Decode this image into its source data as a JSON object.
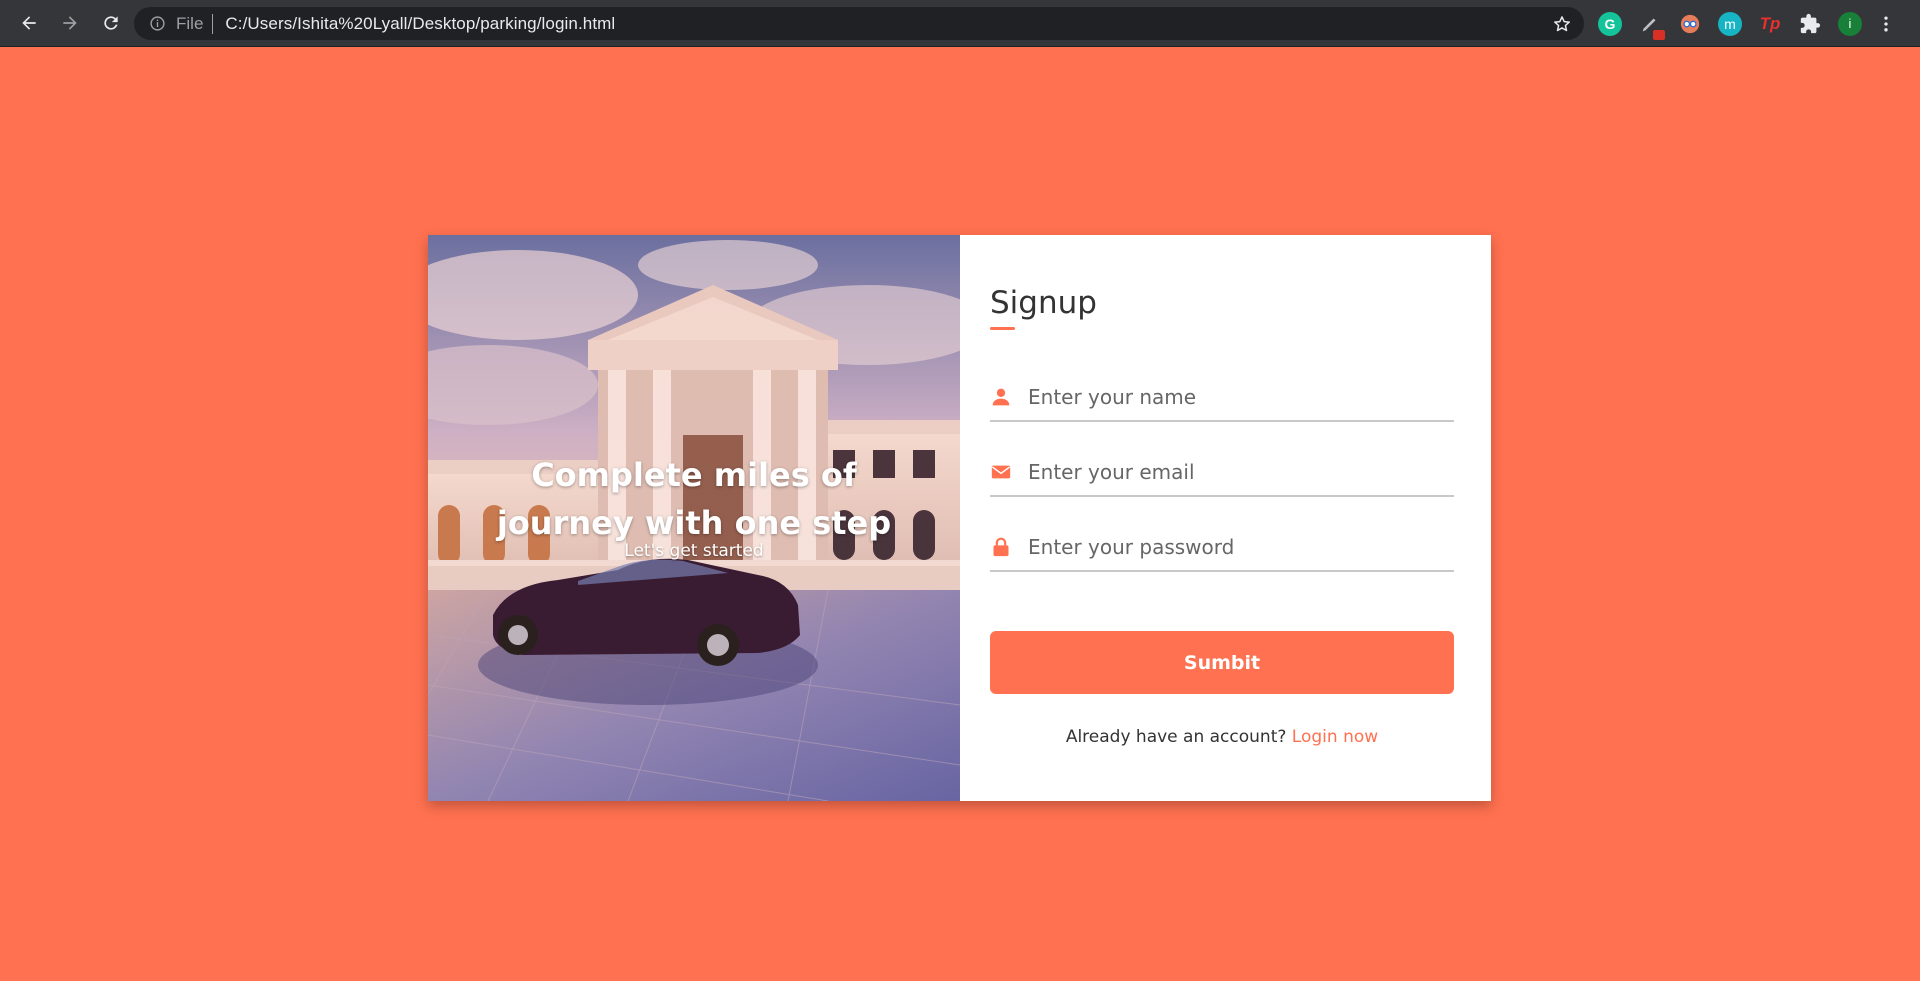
{
  "browser": {
    "omnibox": {
      "scheme_label": "File",
      "url": "C:/Users/Ishita%20Lyall/Desktop/parking/login.html"
    },
    "extensions": [
      {
        "name": "grammarly-icon",
        "label": "G"
      },
      {
        "name": "pen-extension-icon",
        "label": ""
      },
      {
        "name": "glasses-extension-icon",
        "label": ""
      },
      {
        "name": "m-extension-icon",
        "label": "m"
      },
      {
        "name": "tp-extension-icon",
        "label": "Tp"
      },
      {
        "name": "puzzle-icon",
        "label": ""
      },
      {
        "name": "profile-avatar",
        "label": "i"
      }
    ]
  },
  "hero": {
    "title": "Complete miles of journey with one step",
    "subtitle": "Let's get started"
  },
  "form": {
    "title": "Signup",
    "fields": {
      "name": {
        "placeholder": "Enter your name",
        "icon": "user-icon"
      },
      "email": {
        "placeholder": "Enter your email",
        "icon": "envelope-icon"
      },
      "password": {
        "placeholder": "Enter your password",
        "icon": "lock-icon"
      }
    },
    "submit_label": "Sumbit",
    "login_prompt": "Already have an account?",
    "login_link": "Login now"
  },
  "colors": {
    "accent": "#ff7150",
    "toolbar": "#35363a",
    "omnibox": "#202124"
  }
}
